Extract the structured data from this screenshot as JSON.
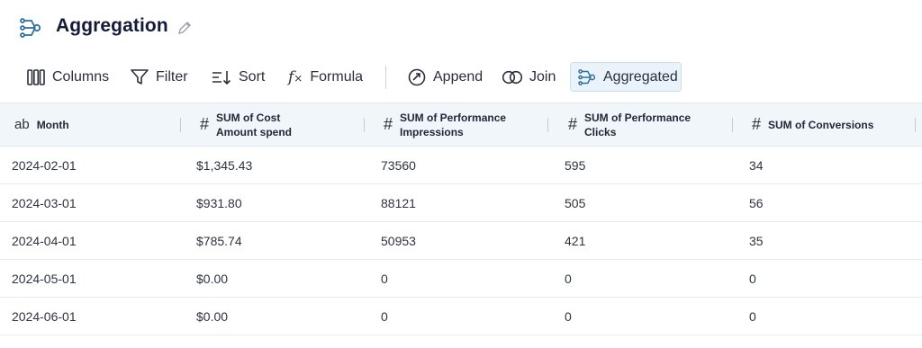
{
  "header": {
    "title": "Aggregation",
    "title_icon": "aggregate-icon",
    "edit_icon": "pencil-icon"
  },
  "toolbar": {
    "columns": "Columns",
    "filter": "Filter",
    "sort": "Sort",
    "formula": "Formula",
    "append": "Append",
    "join": "Join",
    "aggregated": "Aggregated",
    "active_item": "Aggregated",
    "accent_color": "#eaf3f9"
  },
  "table": {
    "columns": [
      {
        "type": "ab",
        "label": "Month"
      },
      {
        "type": "#",
        "label_line1": "SUM of Cost",
        "label_line2": "Amount spend"
      },
      {
        "type": "#",
        "label_line1": "SUM of Performance",
        "label_line2": "Impressions"
      },
      {
        "type": "#",
        "label_line1": "SUM of Performance",
        "label_line2": "Clicks"
      },
      {
        "type": "#",
        "label": "SUM of Conversions"
      }
    ],
    "rows": [
      [
        "2024-02-01",
        "$1,345.43",
        "73560",
        "595",
        "34"
      ],
      [
        "2024-03-01",
        "$931.80",
        "88121",
        "505",
        "56"
      ],
      [
        "2024-04-01",
        "$785.74",
        "50953",
        "421",
        "35"
      ],
      [
        "2024-05-01",
        "$0.00",
        "0",
        "0",
        "0"
      ],
      [
        "2024-06-01",
        "$0.00",
        "0",
        "0",
        "0"
      ]
    ]
  }
}
